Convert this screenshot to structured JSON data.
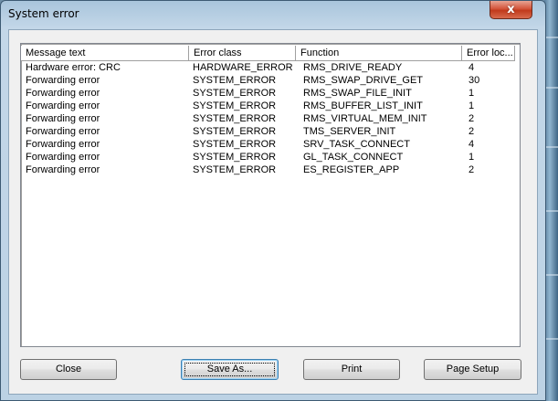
{
  "window": {
    "title": "System error",
    "close_glyph": "x"
  },
  "table": {
    "columns": [
      "Message text",
      "Error class",
      "Function",
      "Error loc..."
    ],
    "rows": [
      [
        "Hardware error: CRC",
        "HARDWARE_ERROR",
        "RMS_DRIVE_READY",
        "4"
      ],
      [
        "Forwarding error",
        "SYSTEM_ERROR",
        "RMS_SWAP_DRIVE_GET",
        "30"
      ],
      [
        "Forwarding error",
        "SYSTEM_ERROR",
        "RMS_SWAP_FILE_INIT",
        "1"
      ],
      [
        "Forwarding error",
        "SYSTEM_ERROR",
        "RMS_BUFFER_LIST_INIT",
        "1"
      ],
      [
        "Forwarding error",
        "SYSTEM_ERROR",
        "RMS_VIRTUAL_MEM_INIT",
        "2"
      ],
      [
        "Forwarding error",
        "SYSTEM_ERROR",
        "TMS_SERVER_INIT",
        "2"
      ],
      [
        "Forwarding error",
        "SYSTEM_ERROR",
        "SRV_TASK_CONNECT",
        "4"
      ],
      [
        "Forwarding error",
        "SYSTEM_ERROR",
        "GL_TASK_CONNECT",
        "1"
      ],
      [
        "Forwarding error",
        "SYSTEM_ERROR",
        "ES_REGISTER_APP",
        "2"
      ]
    ]
  },
  "buttons": {
    "close": "Close",
    "save_as": "Save As...",
    "print": "Print",
    "page_setup": "Page Setup"
  },
  "colors": {
    "close_button": "#c13a1c",
    "default_button_border": "#3c7fb1"
  }
}
